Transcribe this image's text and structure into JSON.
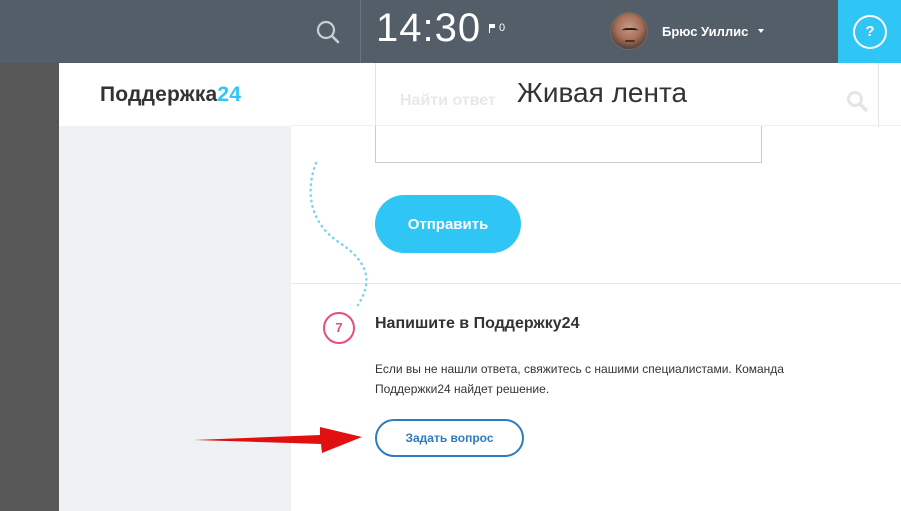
{
  "topbar": {
    "time": "14:30",
    "flag_count": "0",
    "user_name": "Брюс Уиллис",
    "help_label": "?"
  },
  "sidebar": {
    "logo_text": "Поддержка",
    "logo_accent": "24"
  },
  "main": {
    "title": "Живая лента",
    "search_placeholder": "Найти ответ",
    "send_button": "Отправить",
    "step_number": "7",
    "section_title": "Напишите в Поддержку24",
    "section_text": "Если вы не нашли ответа, свяжитесь с нашими специалистами. Команда Поддержки24 найдет решение.",
    "ask_button": "Задать вопрос"
  },
  "colors": {
    "topbar": "#545e69",
    "accent": "#2fc6f6",
    "step": "#e84d79",
    "link_button": "#2e7bbf",
    "arrow": "#e01010"
  },
  "icons": [
    "search-icon",
    "flag-icon",
    "caret-down-icon",
    "help-icon",
    "dotted-trail",
    "red-arrow"
  ]
}
